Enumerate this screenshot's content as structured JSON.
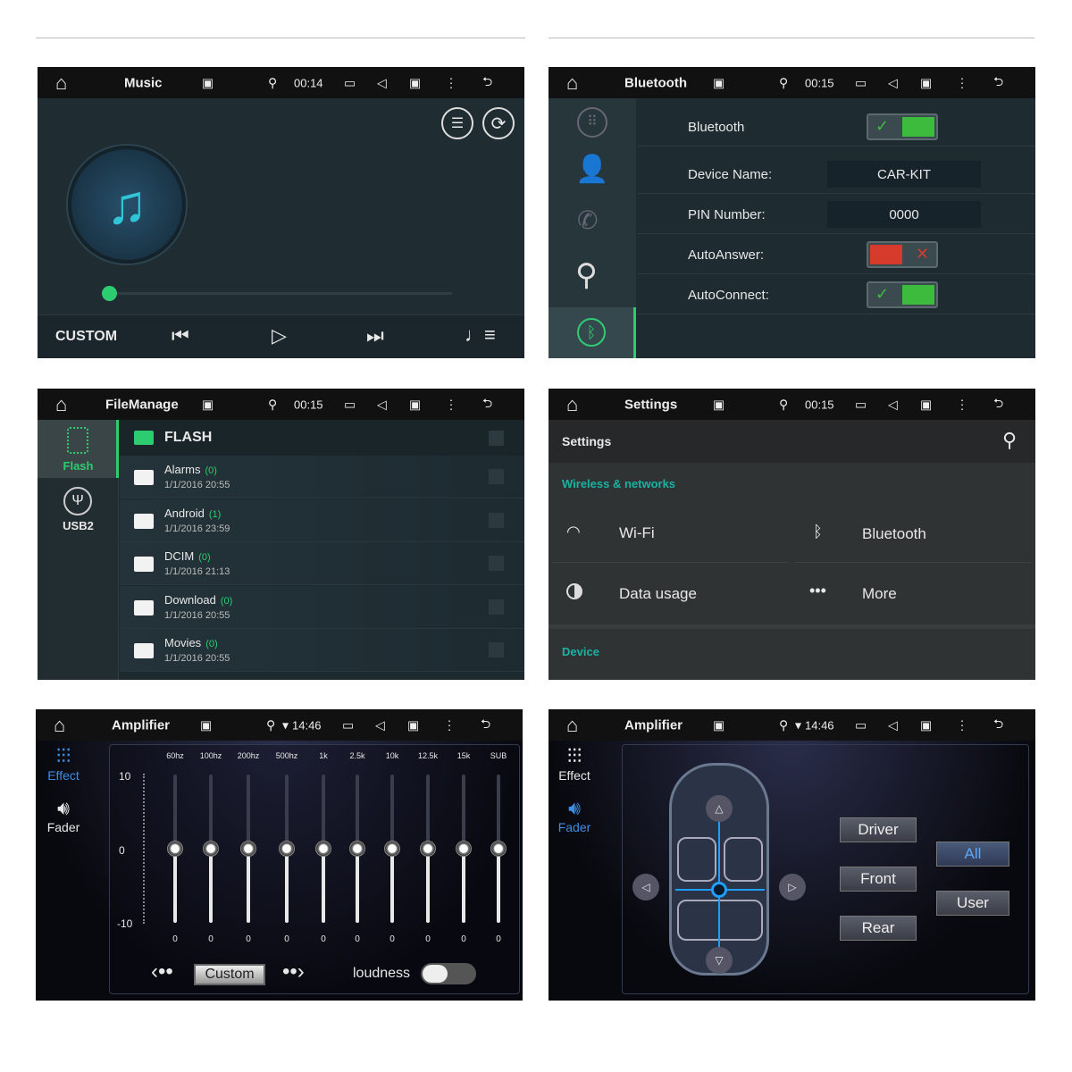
{
  "colors": {
    "accent_green": "#2ecc71",
    "accent_teal": "#18b3a3",
    "accent_blue": "#3d8ee6",
    "toggle_on": "#3dbb3d",
    "toggle_off": "#d63a2a"
  },
  "panels": {
    "music": {
      "status": {
        "title": "Music",
        "time": "00:14",
        "wifi": false
      },
      "custom_label": "CUSTOM",
      "progress": 0
    },
    "bluetooth": {
      "status": {
        "title": "Bluetooth",
        "time": "00:15",
        "wifi": false
      },
      "rows": [
        {
          "label": "Bluetooth",
          "type": "toggle",
          "on": true
        },
        {
          "label": "Device Name:",
          "type": "value",
          "value": "CAR-KIT"
        },
        {
          "label": "PIN Number:",
          "type": "value",
          "value": "0000"
        },
        {
          "label": "AutoAnswer:",
          "type": "toggle",
          "on": false
        },
        {
          "label": "AutoConnect:",
          "type": "toggle",
          "on": true
        }
      ]
    },
    "files": {
      "status": {
        "title": "FileManage",
        "time": "00:15",
        "wifi": false
      },
      "sidebar": [
        {
          "label": "Flash",
          "selected": true
        },
        {
          "label": "USB2",
          "selected": false
        }
      ],
      "root": "FLASH",
      "items": [
        {
          "name": "Alarms",
          "count": "(0)",
          "date": "1/1/2016 20:55"
        },
        {
          "name": "Android",
          "count": "(1)",
          "date": "1/1/2016 23:59"
        },
        {
          "name": "DCIM",
          "count": "(0)",
          "date": "1/1/2016 21:13"
        },
        {
          "name": "Download",
          "count": "(0)",
          "date": "1/1/2016 20:55"
        },
        {
          "name": "Movies",
          "count": "(0)",
          "date": "1/1/2016 20:55"
        }
      ]
    },
    "settings": {
      "status": {
        "title": "Settings",
        "time": "00:15",
        "wifi": false
      },
      "header": "Settings",
      "section1": "Wireless & networks",
      "wifi": "Wi-Fi",
      "bluetooth": "Bluetooth",
      "data_usage": "Data usage",
      "more": "More",
      "section2": "Device"
    },
    "eq": {
      "status": {
        "title": "Amplifier",
        "time": "14:46",
        "wifi": true
      },
      "side": [
        {
          "label": "Effect",
          "selected": true
        },
        {
          "label": "Fader",
          "selected": false
        }
      ],
      "scale": {
        "max": "10",
        "mid": "0",
        "min": "-10"
      },
      "bands": [
        {
          "label": "60hz",
          "value": 0
        },
        {
          "label": "100hz",
          "value": 0
        },
        {
          "label": "200hz",
          "value": 0
        },
        {
          "label": "500hz",
          "value": 0
        },
        {
          "label": "1k",
          "value": 0
        },
        {
          "label": "2.5k",
          "value": 0
        },
        {
          "label": "10k",
          "value": 0
        },
        {
          "label": "12.5k",
          "value": 0
        },
        {
          "label": "15k",
          "value": 0
        },
        {
          "label": "SUB",
          "value": 0
        }
      ],
      "preset": "Custom",
      "loudness_label": "loudness",
      "loudness_on": false
    },
    "fader": {
      "status": {
        "title": "Amplifier",
        "time": "14:46",
        "wifi": true
      },
      "side": [
        {
          "label": "Effect",
          "selected": false
        },
        {
          "label": "Fader",
          "selected": true
        }
      ],
      "buttons": {
        "driver": "Driver",
        "front": "Front",
        "rear": "Rear",
        "all": "All",
        "user": "User"
      }
    }
  }
}
